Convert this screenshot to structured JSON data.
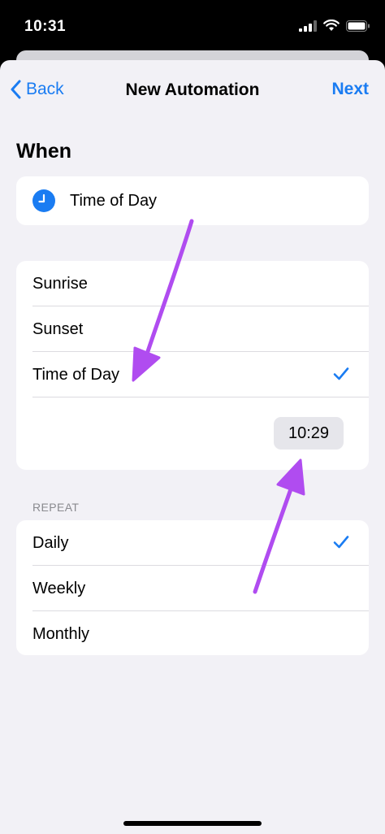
{
  "status_bar": {
    "time": "10:31",
    "icons": [
      "cellular-signal-icon",
      "wifi-icon",
      "battery-icon"
    ]
  },
  "nav": {
    "back_label": "Back",
    "title": "New Automation",
    "next_label": "Next"
  },
  "when_section": {
    "title": "When",
    "trigger": {
      "icon": "clock-icon",
      "label": "Time of Day"
    }
  },
  "time_options": {
    "items": [
      {
        "label": "Sunrise",
        "selected": false
      },
      {
        "label": "Sunset",
        "selected": false
      },
      {
        "label": "Time of Day",
        "selected": true
      }
    ],
    "time_value": "10:29"
  },
  "repeat_section": {
    "header": "REPEAT",
    "items": [
      {
        "label": "Daily",
        "selected": true
      },
      {
        "label": "Weekly",
        "selected": false
      },
      {
        "label": "Monthly",
        "selected": false
      }
    ]
  },
  "colors": {
    "accent": "#1a7cf2",
    "annotation_arrow": "#b04cf0",
    "background": "#f2f1f6"
  }
}
